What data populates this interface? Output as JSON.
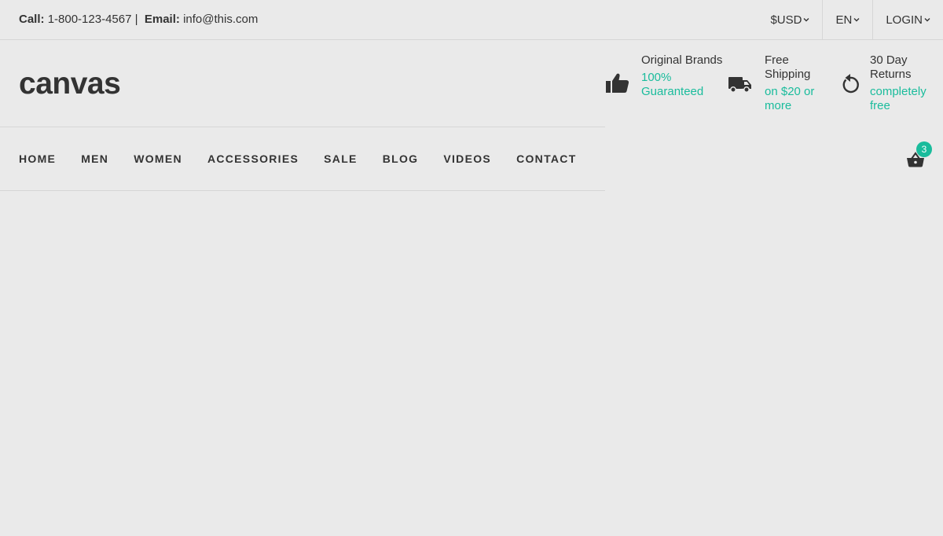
{
  "topbar": {
    "call_label": "Call:",
    "phone": "1-800-123-4567",
    "separator": "|",
    "email_label": "Email:",
    "email": "info@this.com",
    "currency": "$USD",
    "language": "EN",
    "login": "LOGIN"
  },
  "header": {
    "logo": "canvas",
    "features": [
      {
        "title": "Original Brands",
        "subtitle": "100% Guaranteed",
        "icon": "thumbs-up-icon"
      },
      {
        "title": "Free Shipping",
        "subtitle": "on $20 or more",
        "icon": "truck-icon"
      },
      {
        "title": "30 Day Returns",
        "subtitle": "completely free",
        "icon": "undo-icon"
      }
    ]
  },
  "nav": {
    "items": [
      "HOME",
      "MEN",
      "WOMEN",
      "ACCESSORIES",
      "SALE",
      "BLOG",
      "VIDEOS",
      "CONTACT"
    ]
  },
  "cart": {
    "count": "3",
    "icon": "basket-icon"
  },
  "colors": {
    "background": "#eaeaea",
    "accent": "#1abc9c",
    "text": "#333333"
  }
}
